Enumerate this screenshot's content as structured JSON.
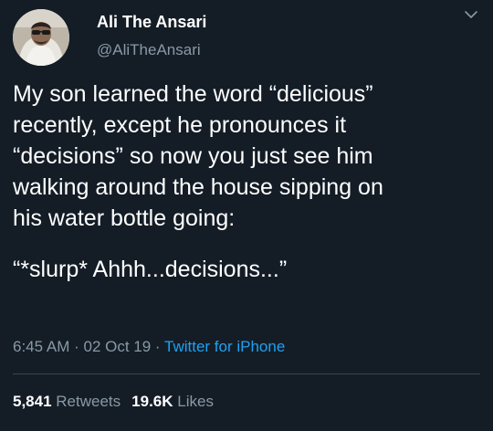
{
  "author": {
    "name": "Ali The Ansari",
    "handle": "@AliTheAnsari"
  },
  "tweet": {
    "lines": [
      "My son learned the word “delicious”",
      "recently, except he pronounces it",
      "“decisions” so now you just see him",
      "walking around the house sipping on",
      "his water bottle going:"
    ],
    "quote": "“*slurp* Ahhh...decisions...”"
  },
  "meta": {
    "time": "6:45 AM",
    "separator": " · ",
    "date": "02 Oct 19",
    "source": "Twitter for iPhone"
  },
  "stats": {
    "retweets_count": "5,841",
    "retweets_label": "Retweets",
    "likes_count": "19.6K",
    "likes_label": "Likes"
  },
  "colors": {
    "background": "#141d26",
    "text": "#ffffff",
    "secondary": "#8899a6",
    "link": "#1da1f2"
  },
  "icons": {
    "menu": "chevron-down-icon"
  }
}
